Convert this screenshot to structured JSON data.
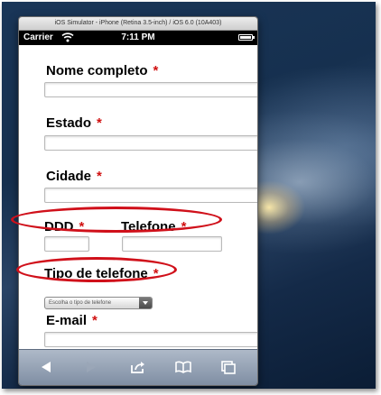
{
  "simulator": {
    "title": "iOS Simulator - iPhone (Retina 3.5-inch) / iOS 6.0 (10A403)"
  },
  "statusbar": {
    "carrier": "Carrier",
    "time": "7:11 PM",
    "battery_level": 1.0
  },
  "form": {
    "required_marker": "*",
    "fields": {
      "nome": {
        "label": "Nome completo"
      },
      "estado": {
        "label": "Estado"
      },
      "cidade": {
        "label": "Cidade"
      },
      "ddd": {
        "label": "DDD"
      },
      "telefone": {
        "label": "Telefone"
      },
      "tipo": {
        "label": "Tipo de telefone",
        "selected": "Escolha o tipo de telefone"
      },
      "email": {
        "label": "E-mail"
      }
    }
  },
  "toolbar": {
    "icons": [
      "back-arrow-icon",
      "forward-arrow-icon",
      "share-icon",
      "bookmarks-icon",
      "tabs-icon"
    ]
  },
  "annotation": {
    "color": "#d0101a"
  }
}
